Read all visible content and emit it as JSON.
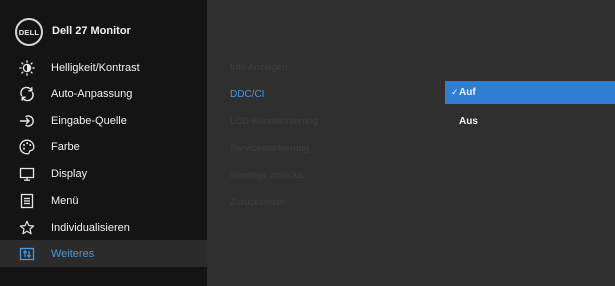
{
  "header": {
    "brand": "DELL",
    "model": "Dell 27 Monitor"
  },
  "menu": {
    "items": [
      {
        "label": "Helligkeit/Kontrast",
        "icon": "brightness-icon"
      },
      {
        "label": "Auto-Anpassung",
        "icon": "auto-adjust-icon"
      },
      {
        "label": "Eingabe-Quelle",
        "icon": "input-source-icon"
      },
      {
        "label": "Farbe",
        "icon": "color-icon"
      },
      {
        "label": "Display",
        "icon": "display-icon"
      },
      {
        "label": "Menü",
        "icon": "menu-icon"
      },
      {
        "label": "Individualisieren",
        "icon": "star-icon"
      },
      {
        "label": "Weiteres",
        "icon": "others-icon"
      }
    ],
    "active_label": "Weiteres"
  },
  "submenu": {
    "items": [
      {
        "label": "Info Anzeigen"
      },
      {
        "label": "DDC/CI"
      },
      {
        "label": "LCD-Konditionierung"
      },
      {
        "label": "Servicemarkierung"
      },
      {
        "label": "Sonstige zurücks."
      },
      {
        "label": "Zurücksetzen"
      }
    ],
    "highlighted_label": "DDC/CI"
  },
  "options": {
    "items": [
      {
        "label": "Auf",
        "check": "✓"
      },
      {
        "label": "Aus"
      }
    ],
    "selected_label": "Auf"
  },
  "colors": {
    "accent": "#3d9be9",
    "selection": "#2e7ed3",
    "menu_bg": "#141414",
    "panel_bg": "#2f2f2f"
  }
}
